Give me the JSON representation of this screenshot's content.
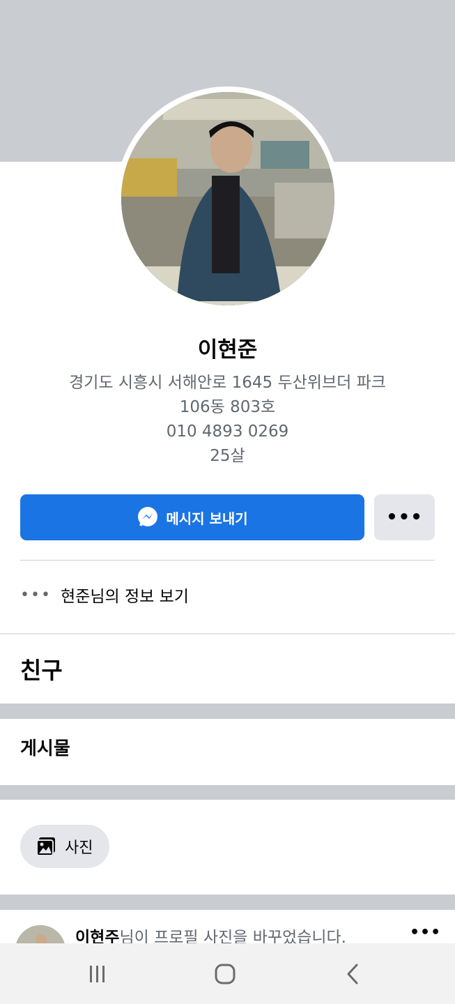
{
  "profile": {
    "name": "이현준",
    "bio_lines": [
      "경기도 시흥시 서해안로 1645 두산위브더 파크",
      "106동 803호",
      "010 4893 0269",
      "25살"
    ]
  },
  "actions": {
    "message_label": "메시지 보내기",
    "more_label": "•••"
  },
  "info_row": {
    "dots": "•••",
    "label": "현준님의 정보 보기"
  },
  "sections": {
    "friends_title": "친구",
    "posts_title": "게시물",
    "photos_chip_label": "사진"
  },
  "post": {
    "author": "이현주",
    "text": "님이 프로필 사진을 바꾸었습니다.",
    "more_label": "•••"
  },
  "colors": {
    "cover": "#c9ccd1",
    "accent": "#1b74e4",
    "secondary_button": "#e4e6eb",
    "muted_text": "#606770"
  },
  "icons": {
    "message": "messenger-icon",
    "photos": "photo-album-icon",
    "nav_recent": "recent-apps-icon",
    "nav_home": "home-icon",
    "nav_back": "back-icon"
  }
}
